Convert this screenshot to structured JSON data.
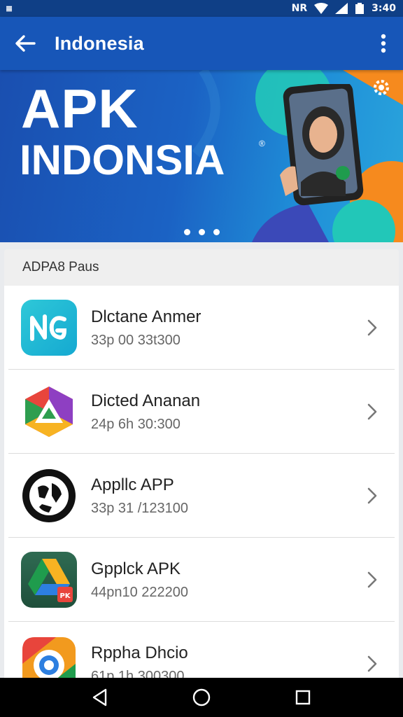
{
  "status_bar": {
    "left": "≣",
    "network": "NR",
    "time": "3:40"
  },
  "app_bar": {
    "title": "Indonesia"
  },
  "banner": {
    "line1": "APK",
    "line2": "INDONSIA",
    "reg_mark": "®",
    "page_count": 3,
    "colors": {
      "background": "#1b62c4",
      "accent_orange": "#f68a1e",
      "accent_teal": "#22c7b8"
    }
  },
  "section": {
    "title": "ADPA8 Paus"
  },
  "apps": [
    {
      "name": "Dlctane Anmer",
      "meta": "33p 00 33t300",
      "icon": "nc-app-icon"
    },
    {
      "name": "Dicted Ananan",
      "meta": "24p 6h 30:300",
      "icon": "triangle-app-icon"
    },
    {
      "name": "Appllc APP",
      "meta": "33p 31 /123100",
      "icon": "globe-app-icon"
    },
    {
      "name": "Gpplck APK",
      "meta": "44pn10 222200",
      "icon": "drive-app-icon"
    },
    {
      "name": "Rppha Dhcio",
      "meta": "61p 1h 300300",
      "icon": "camera-app-icon"
    }
  ],
  "colors": {
    "app_bar": "#1756b8",
    "status_bar": "#0f3f86"
  }
}
